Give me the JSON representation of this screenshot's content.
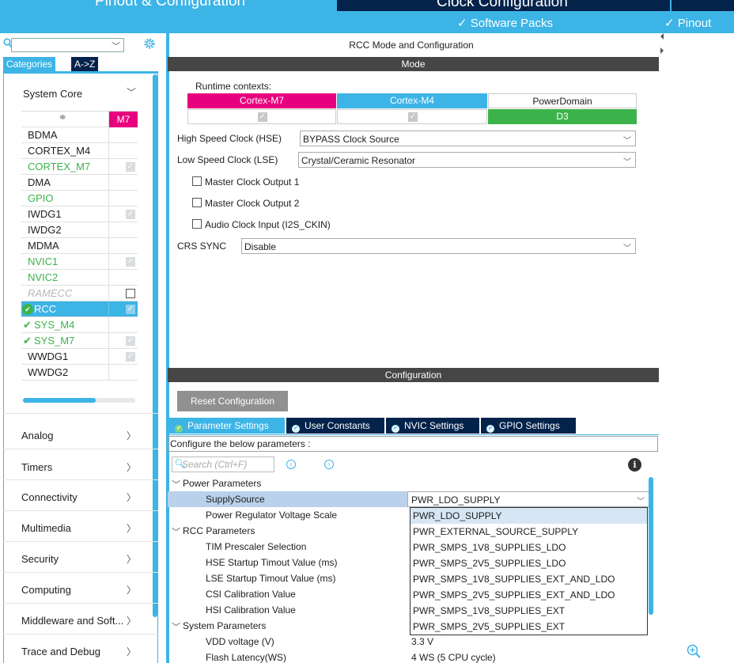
{
  "header": {
    "tabs": [
      {
        "label": "Pinout & Configuration"
      },
      {
        "label": "Clock Configuration"
      }
    ],
    "menus": {
      "software_packs": "✓ Software Packs",
      "pinout": "✓ Pinout"
    }
  },
  "left_panel": {
    "search": {
      "value": ""
    },
    "tabs": {
      "categories": "Categories",
      "az": "A->Z"
    },
    "system_core": {
      "label": "System Core",
      "column_header": "M7",
      "items": [
        {
          "name": "BDMA",
          "state": "none",
          "checkbox": "none"
        },
        {
          "name": "CORTEX_M4",
          "state": "none",
          "checkbox": "none"
        },
        {
          "name": "CORTEX_M7",
          "state": "green",
          "checkbox": "checked"
        },
        {
          "name": "DMA",
          "state": "none",
          "checkbox": "none"
        },
        {
          "name": "GPIO",
          "state": "green",
          "checkbox": "none"
        },
        {
          "name": "IWDG1",
          "state": "none",
          "checkbox": "checked"
        },
        {
          "name": "IWDG2",
          "state": "none",
          "checkbox": "none"
        },
        {
          "name": "MDMA",
          "state": "none",
          "checkbox": "none"
        },
        {
          "name": "NVIC1",
          "state": "green",
          "checkbox": "checked"
        },
        {
          "name": "NVIC2",
          "state": "green",
          "checkbox": "none"
        },
        {
          "name": "RAMECC",
          "state": "disabled",
          "checkbox": "empty"
        },
        {
          "name": "RCC",
          "state": "selected",
          "checkbox": "checked"
        },
        {
          "name": "SYS_M4",
          "state": "ok",
          "checkbox": "none"
        },
        {
          "name": "SYS_M7",
          "state": "ok",
          "checkbox": "checked"
        },
        {
          "name": "WWDG1",
          "state": "none",
          "checkbox": "checked"
        },
        {
          "name": "WWDG2",
          "state": "none",
          "checkbox": "none"
        }
      ]
    },
    "categories": [
      {
        "label": "Analog"
      },
      {
        "label": "Timers"
      },
      {
        "label": "Connectivity"
      },
      {
        "label": "Multimedia"
      },
      {
        "label": "Security"
      },
      {
        "label": "Computing"
      },
      {
        "label": "Middleware and Soft..."
      },
      {
        "label": "Trace and Debug"
      }
    ]
  },
  "mode_panel": {
    "title": "RCC Mode and Configuration",
    "mode_header": "Mode",
    "runtime_contexts_label": "Runtime contexts:",
    "contexts": [
      {
        "label": "Cortex-M7",
        "color": "#e6007e"
      },
      {
        "label": "Cortex-M4",
        "color": "#3cb4e6"
      },
      {
        "label": "PowerDomain",
        "color": "#ffffff"
      }
    ],
    "power_domain_value": "D3",
    "hse": {
      "label": "High Speed Clock (HSE)",
      "value": "BYPASS Clock Source"
    },
    "lse": {
      "label": "Low Speed Clock (LSE)",
      "value": "Crystal/Ceramic Resonator"
    },
    "checkboxes": [
      {
        "label": "Master Clock Output 1"
      },
      {
        "label": "Master Clock Output 2"
      },
      {
        "label": "Audio Clock Input (I2S_CKIN)"
      }
    ],
    "crs_sync": {
      "label": "CRS SYNC",
      "value": "Disable"
    }
  },
  "config_panel": {
    "header": "Configuration",
    "reset_button": "Reset Configuration",
    "tabs": [
      {
        "label": "Parameter Settings"
      },
      {
        "label": "User Constants"
      },
      {
        "label": "NVIC Settings"
      },
      {
        "label": "GPIO Settings"
      }
    ],
    "hint": "Configure the below parameters :",
    "search_placeholder": "Search (Ctrl+F)",
    "tree": [
      {
        "kind": "group",
        "label": "Power Parameters"
      },
      {
        "kind": "param",
        "label": "SupplySource",
        "value": "PWR_LDO_SUPPLY",
        "selected": true
      },
      {
        "kind": "param",
        "label": "Power Regulator Voltage Scale",
        "value": ""
      },
      {
        "kind": "group",
        "label": "RCC Parameters"
      },
      {
        "kind": "param",
        "label": "TIM Prescaler Selection",
        "value": ""
      },
      {
        "kind": "param",
        "label": "HSE Startup Timout Value (ms)",
        "value": ""
      },
      {
        "kind": "param",
        "label": "LSE Startup Timout Value (ms)",
        "value": ""
      },
      {
        "kind": "param",
        "label": "CSI Calibration Value",
        "value": ""
      },
      {
        "kind": "param",
        "label": "HSI Calibration Value",
        "value": ""
      },
      {
        "kind": "group",
        "label": "System Parameters"
      },
      {
        "kind": "param",
        "label": "VDD voltage (V)",
        "value": "3.3 V"
      },
      {
        "kind": "param",
        "label": "Flash Latency(WS)",
        "value": "4 WS (5 CPU cycle)"
      }
    ],
    "dropdown_options": [
      "PWR_LDO_SUPPLY",
      "PWR_EXTERNAL_SOURCE_SUPPLY",
      "PWR_SMPS_1V8_SUPPLIES_LDO",
      "PWR_SMPS_2V5_SUPPLIES_LDO",
      "PWR_SMPS_1V8_SUPPLIES_EXT_AND_LDO",
      "PWR_SMPS_2V5_SUPPLIES_EXT_AND_LDO",
      "PWR_SMPS_1V8_SUPPLIES_EXT",
      "PWR_SMPS_2V5_SUPPLIES_EXT"
    ]
  },
  "colors": {
    "accent": "#3cb4e6",
    "dark": "#03234b",
    "magenta": "#e6007e",
    "green": "#3cb34a"
  }
}
